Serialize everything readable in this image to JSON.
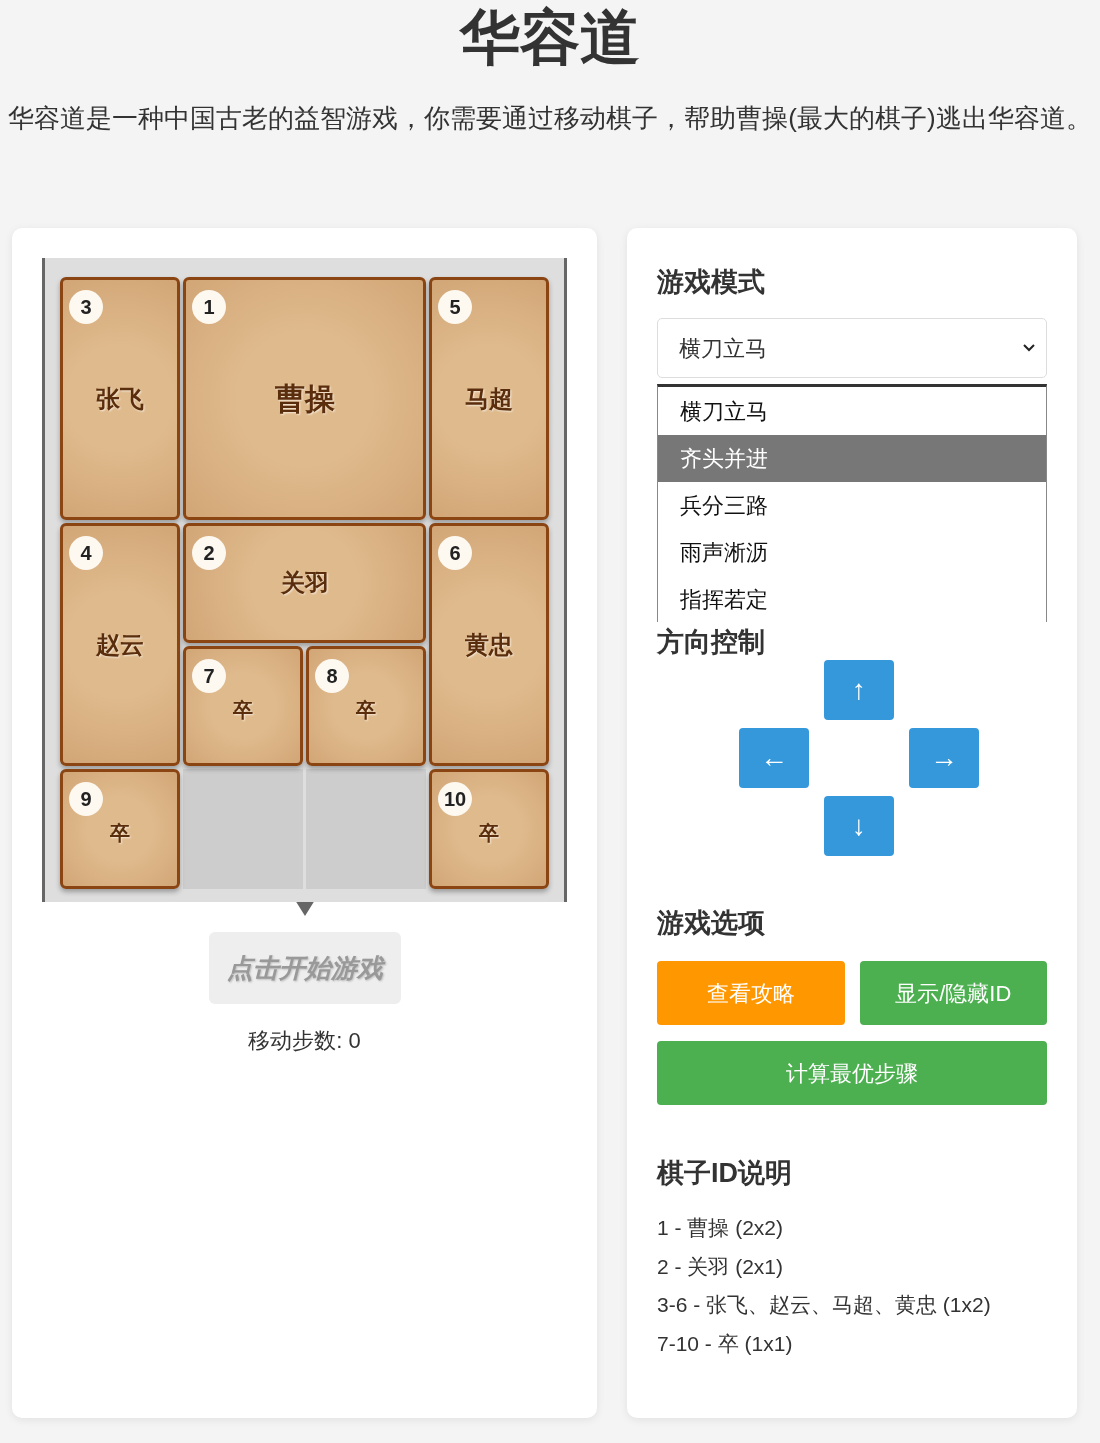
{
  "title": "华容道",
  "intro": "华容道是一种中国古老的益智游戏，你需要通过移动棋子，帮助曹操(最大的棋子)逃出华容道。",
  "board": {
    "pieces": [
      {
        "kind": "tall",
        "id": "3",
        "name": "张飞"
      },
      {
        "kind": "big",
        "id": "1",
        "name": "曹操"
      },
      {
        "kind": "tall",
        "id": "5",
        "name": "马超"
      },
      {
        "kind": "tall",
        "id": "4",
        "name": "赵云"
      },
      {
        "kind": "wide",
        "id": "2",
        "name": "关羽"
      },
      {
        "kind": "tall",
        "id": "6",
        "name": "黄忠"
      },
      {
        "kind": "small",
        "id": "7",
        "name": "卒"
      },
      {
        "kind": "small",
        "id": "8",
        "name": "卒"
      },
      {
        "kind": "small",
        "id": "9",
        "name": "卒"
      },
      {
        "kind": "empty"
      },
      {
        "kind": "empty"
      },
      {
        "kind": "small",
        "id": "10",
        "name": "卒"
      }
    ]
  },
  "start_button": {
    "label": "点击开始游戏",
    "disabled": true
  },
  "moves": "移动步数: 0",
  "mode": {
    "heading": "游戏模式",
    "value": "横刀立马",
    "options": [
      {
        "label": "横刀立马",
        "highlighted": false
      },
      {
        "label": "齐头并进",
        "highlighted": true
      },
      {
        "label": "兵分三路",
        "highlighted": false
      },
      {
        "label": "雨声淅沥",
        "highlighted": false
      },
      {
        "label": "指挥若定",
        "highlighted": false
      }
    ]
  },
  "direction": {
    "heading": "方向控制",
    "buttons": [
      {
        "kind": "up",
        "label": "↑"
      },
      {
        "kind": "left",
        "label": "←"
      },
      {
        "kind": "right",
        "label": "→"
      },
      {
        "kind": "down",
        "label": "↓"
      }
    ]
  },
  "options": {
    "heading": "游戏选项",
    "buttons": [
      {
        "kind": "orange",
        "label": "查看攻略"
      },
      {
        "kind": "green",
        "label": "显示/隐藏ID"
      },
      {
        "kind": "wide",
        "label": "计算最优步骤"
      }
    ]
  },
  "legend": {
    "heading": "棋子ID说明",
    "lines": [
      "1 - 曹操 (2x2)",
      "2 - 关羽 (2x1)",
      "3-6 - 张飞、赵云、马超、黄忠 (1x2)",
      "7-10 - 卒 (1x1)"
    ]
  }
}
